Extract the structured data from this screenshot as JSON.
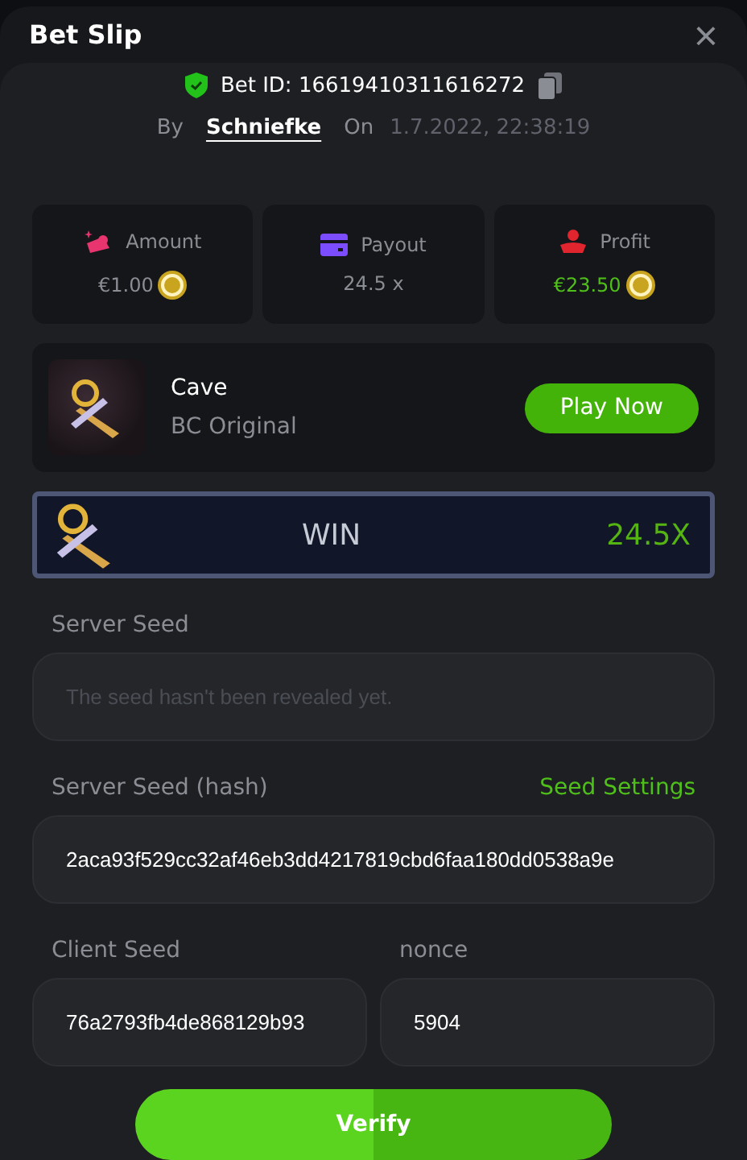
{
  "dialog": {
    "title": "Bet Slip",
    "close": "×"
  },
  "bet": {
    "id_label": "Bet ID: 16619410311616272",
    "by_label": "By",
    "user": "Schniefke",
    "on_label": "On",
    "date": "1.7.2022, 22:38:19"
  },
  "stats": [
    {
      "kind": "amount",
      "label": "Amount",
      "value": "€1.00",
      "coin": true,
      "color": "#e8356f",
      "positive": false
    },
    {
      "kind": "payout",
      "label": "Payout",
      "value": "24.5 x",
      "coin": false,
      "color": "#7b4dff",
      "positive": false
    },
    {
      "kind": "profit",
      "label": "Profit",
      "value": "€23.50",
      "coin": true,
      "color": "#e0252f",
      "positive": true
    }
  ],
  "game": {
    "name": "Cave",
    "provider": "BC Original",
    "button": "Play Now"
  },
  "result": {
    "label": "WIN",
    "multiplier": "24.5X"
  },
  "server_seed": {
    "label": "Server Seed",
    "placeholder": "The seed hasn't been revealed yet."
  },
  "server_seed_hash": {
    "label": "Server Seed (hash)",
    "link": "Seed Settings",
    "value": "2aca93f529cc32af46eb3dd4217819cbd6faa180dd0538a9e"
  },
  "client_seed": {
    "label": "Client Seed",
    "value": "76a2793fb4de868129b93"
  },
  "nonce": {
    "label": "nonce",
    "value": "5904"
  },
  "verify_button": "Verify"
}
